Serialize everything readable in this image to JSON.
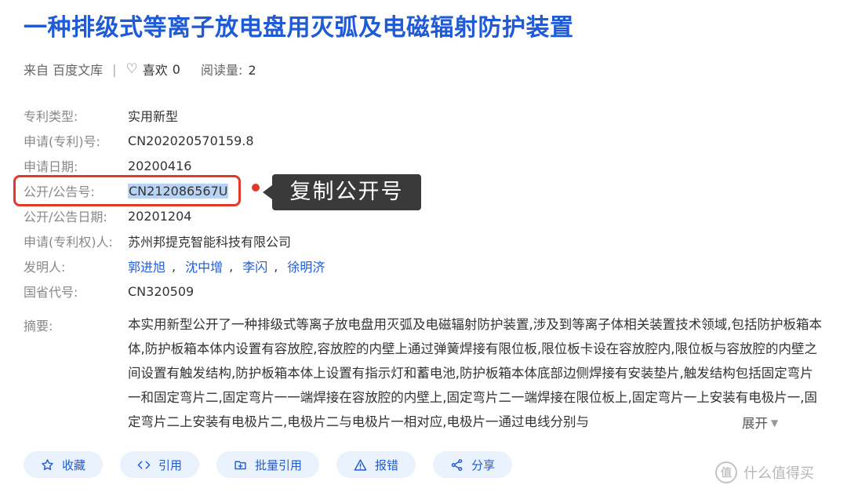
{
  "title": "一种排级式等离子放电盘用灭弧及电磁辐射防护装置",
  "meta": {
    "source": "来自 百度文库",
    "sep": "|",
    "like_label": "喜欢",
    "like_count": "0",
    "reads_label": "阅读量:",
    "reads_count": "2"
  },
  "fields": {
    "patent_type": {
      "label": "专利类型:",
      "value": "实用新型"
    },
    "app_no": {
      "label": "申请(专利)号:",
      "value": "CN202020570159.8"
    },
    "app_date": {
      "label": "申请日期:",
      "value": "20200416"
    },
    "pub_no": {
      "label": "公开/公告号:",
      "value": "CN212086567U"
    },
    "pub_date": {
      "label": "公开/公告日期:",
      "value": "20201204"
    },
    "applicant": {
      "label": "申请(专利权)人:",
      "value": "苏州邦提克智能科技有限公司"
    },
    "inventors": {
      "label": "发明人:",
      "values": [
        "郭进旭",
        "沈中增",
        "李闪",
        "徐明济"
      ],
      "sep": ","
    },
    "region_code": {
      "label": "国省代号:",
      "value": "CN320509"
    }
  },
  "callout": "复制公开号",
  "abstract": {
    "label": "摘要:",
    "text": "本实用新型公开了一种排级式等离子放电盘用灭弧及电磁辐射防护装置,涉及到等离子体相关装置技术领域,包括防护板箱本体,防护板箱本体内设置有容放腔,容放腔的内壁上通过弹簧焊接有限位板,限位板卡设在容放腔内,限位板与容放腔的内壁之间设置有触发结构,防护板箱本体上设置有指示灯和蓄电池,防护板箱本体底部边侧焊接有安装垫片,触发结构包括固定弯片一和固定弯片二,固定弯片一一端焊接在容放腔的内壁上,固定弯片二一端焊接在限位板上,固定弯片一上安装有电极片一,固定弯片二上安装有电极片二,电极片二与电极片一相对应,电极片一通过电线分别与",
    "expand": "展开"
  },
  "actions": {
    "favorite": "收藏",
    "cite": "引用",
    "batch_cite": "批量引用",
    "report": "报错",
    "share": "分享"
  },
  "watermark": {
    "logo": "值",
    "text": "什么值得买"
  }
}
